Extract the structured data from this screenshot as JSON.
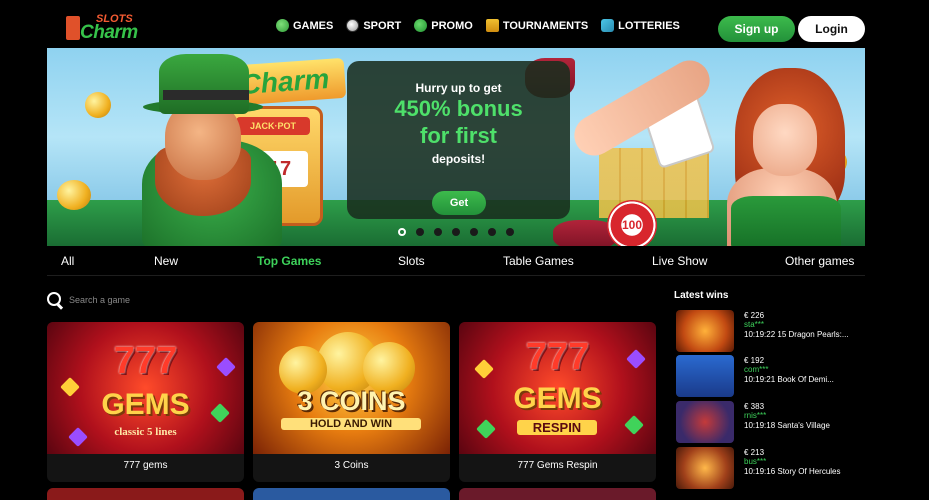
{
  "logo": {
    "top": "SLOTS",
    "main": "Charm"
  },
  "nav": [
    {
      "label": "GAMES",
      "icon": "dice-icon"
    },
    {
      "label": "SPORT",
      "icon": "soccer-ball-icon"
    },
    {
      "label": "PROMO",
      "icon": "clover-icon"
    },
    {
      "label": "TOURNAMENTS",
      "icon": "crown-icon"
    },
    {
      "label": "LOTTERIES",
      "icon": "ticket-icon"
    }
  ],
  "auth": {
    "signup": "Sign up",
    "login": "Login"
  },
  "banner": {
    "sign": "Charm",
    "slot_top": "JACK·POT",
    "slot_window": "777",
    "chip": "100",
    "promo": {
      "line1": "Hurry up to get",
      "line2": "450% bonus",
      "line3": "for first",
      "line4": "deposits!",
      "button": "Get"
    },
    "dots_count": 7,
    "active_dot": 0
  },
  "tabs": [
    "All",
    "New",
    "Top Games",
    "Slots",
    "Table Games",
    "Live Show",
    "Other games"
  ],
  "active_tab": "Top Games",
  "search": {
    "placeholder": "Search a game"
  },
  "games": [
    {
      "title": "777 gems",
      "art_line1": "777",
      "art_line2": "GEMS",
      "art_line3": "classic 5 lines"
    },
    {
      "title": "3 Coins",
      "art_line1": "3 COINS",
      "art_line2": "HOLD AND WIN"
    },
    {
      "title": "777 Gems Respin",
      "art_line1": "777",
      "art_line2": "GEMS",
      "art_line3": "RESPIN"
    }
  ],
  "latest_wins": {
    "title": "Latest wins",
    "items": [
      {
        "amount": "€ 226",
        "user": "sta***",
        "time": "10:19:22",
        "game": "15 Dragon Pearls:..."
      },
      {
        "amount": "€ 192",
        "user": "com***",
        "time": "10:19:21",
        "game": "Book Of Demi..."
      },
      {
        "amount": "€ 383",
        "user": "rnis***",
        "time": "10:19:18",
        "game": "Santa's Village"
      },
      {
        "amount": "€ 213",
        "user": "bus***",
        "time": "10:19:16",
        "game": "Story Of Hercules"
      }
    ]
  },
  "colors": {
    "accent_green": "#3dd15a",
    "brand_orange": "#f45b32",
    "background": "#000000"
  }
}
